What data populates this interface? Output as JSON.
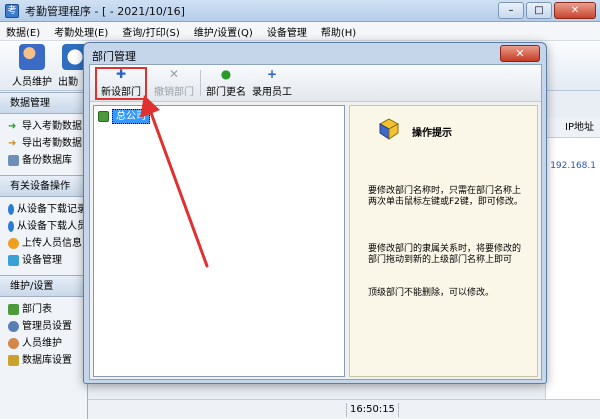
{
  "window": {
    "title": "考勤管理程序 - [ - 2021/10/16]",
    "minimize": "–",
    "maximize": "□",
    "close": "✕"
  },
  "menu": [
    "数据(E)",
    "考勤处理(E)",
    "查询/打印(S)",
    "维护/设置(Q)",
    "设备管理",
    "帮助(H)"
  ],
  "toolbar": {
    "staff_label": "人员维护",
    "out_label": "出勤"
  },
  "leftnav": {
    "section1": "数据管理",
    "s1_items": [
      "导入考勤数据",
      "导出考勤数据",
      "备份数据库"
    ],
    "section2": "有关设备操作",
    "s2_items": [
      "从设备下载记录",
      "从设备下载人员",
      "上传人员信息",
      "设备管理"
    ],
    "section3": "维护/设置",
    "s3_items": [
      "部门表",
      "管理员设置",
      "人员维护",
      "数据库设置"
    ]
  },
  "rightpane": {
    "header": "IP地址",
    "cell": "192.168.1"
  },
  "status": {
    "time": "16:50:15"
  },
  "dialog": {
    "title": "部门管理",
    "close": "✕",
    "buttons": {
      "new": "新设部门",
      "cancel": "撤销部门",
      "rename": "部门更名",
      "hire": "录用员工"
    },
    "tree_root": "总公司",
    "tips": {
      "title": "操作提示",
      "p1": "要修改部门名称时，只需在部门名称上两次单击鼠标左键或F2键，即可修改。",
      "p2": "要修改部门的隶属关系时，将要修改的部门拖动到新的上级部门名称上即可",
      "p3": "顶级部门不能删除，可以修改。"
    }
  },
  "colors": {
    "accent_red": "#e03030",
    "selection": "#3399ff"
  }
}
